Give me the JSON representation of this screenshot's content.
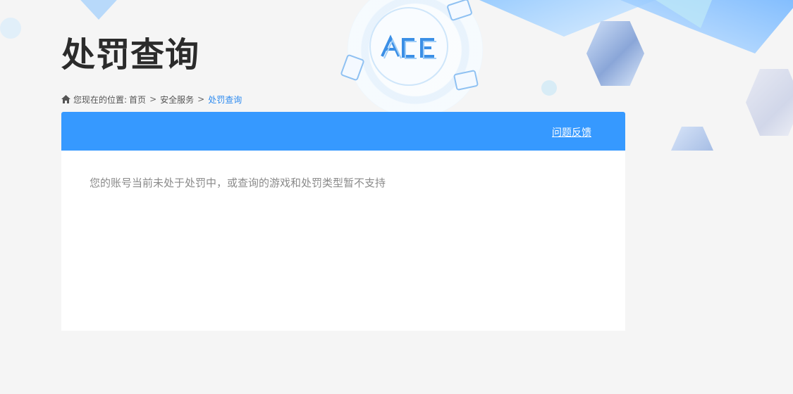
{
  "page": {
    "title": "处罚查询"
  },
  "breadcrumb": {
    "prefix": "您现在的位置:",
    "items": [
      "首页",
      "安全服务"
    ],
    "current": "处罚查询",
    "separator": ">"
  },
  "panel": {
    "feedback_label": "问题反馈",
    "message": "您的账号当前未处于处罚中，或查询的游戏和处罚类型暂不支持"
  },
  "logo": {
    "text": "ACE"
  },
  "colors": {
    "accent": "#3699ff",
    "breadcrumb_current": "#2e8bf0",
    "background": "#f5f5f5",
    "message_text": "#8a8a8a"
  },
  "icons": {
    "home": "home-icon"
  }
}
